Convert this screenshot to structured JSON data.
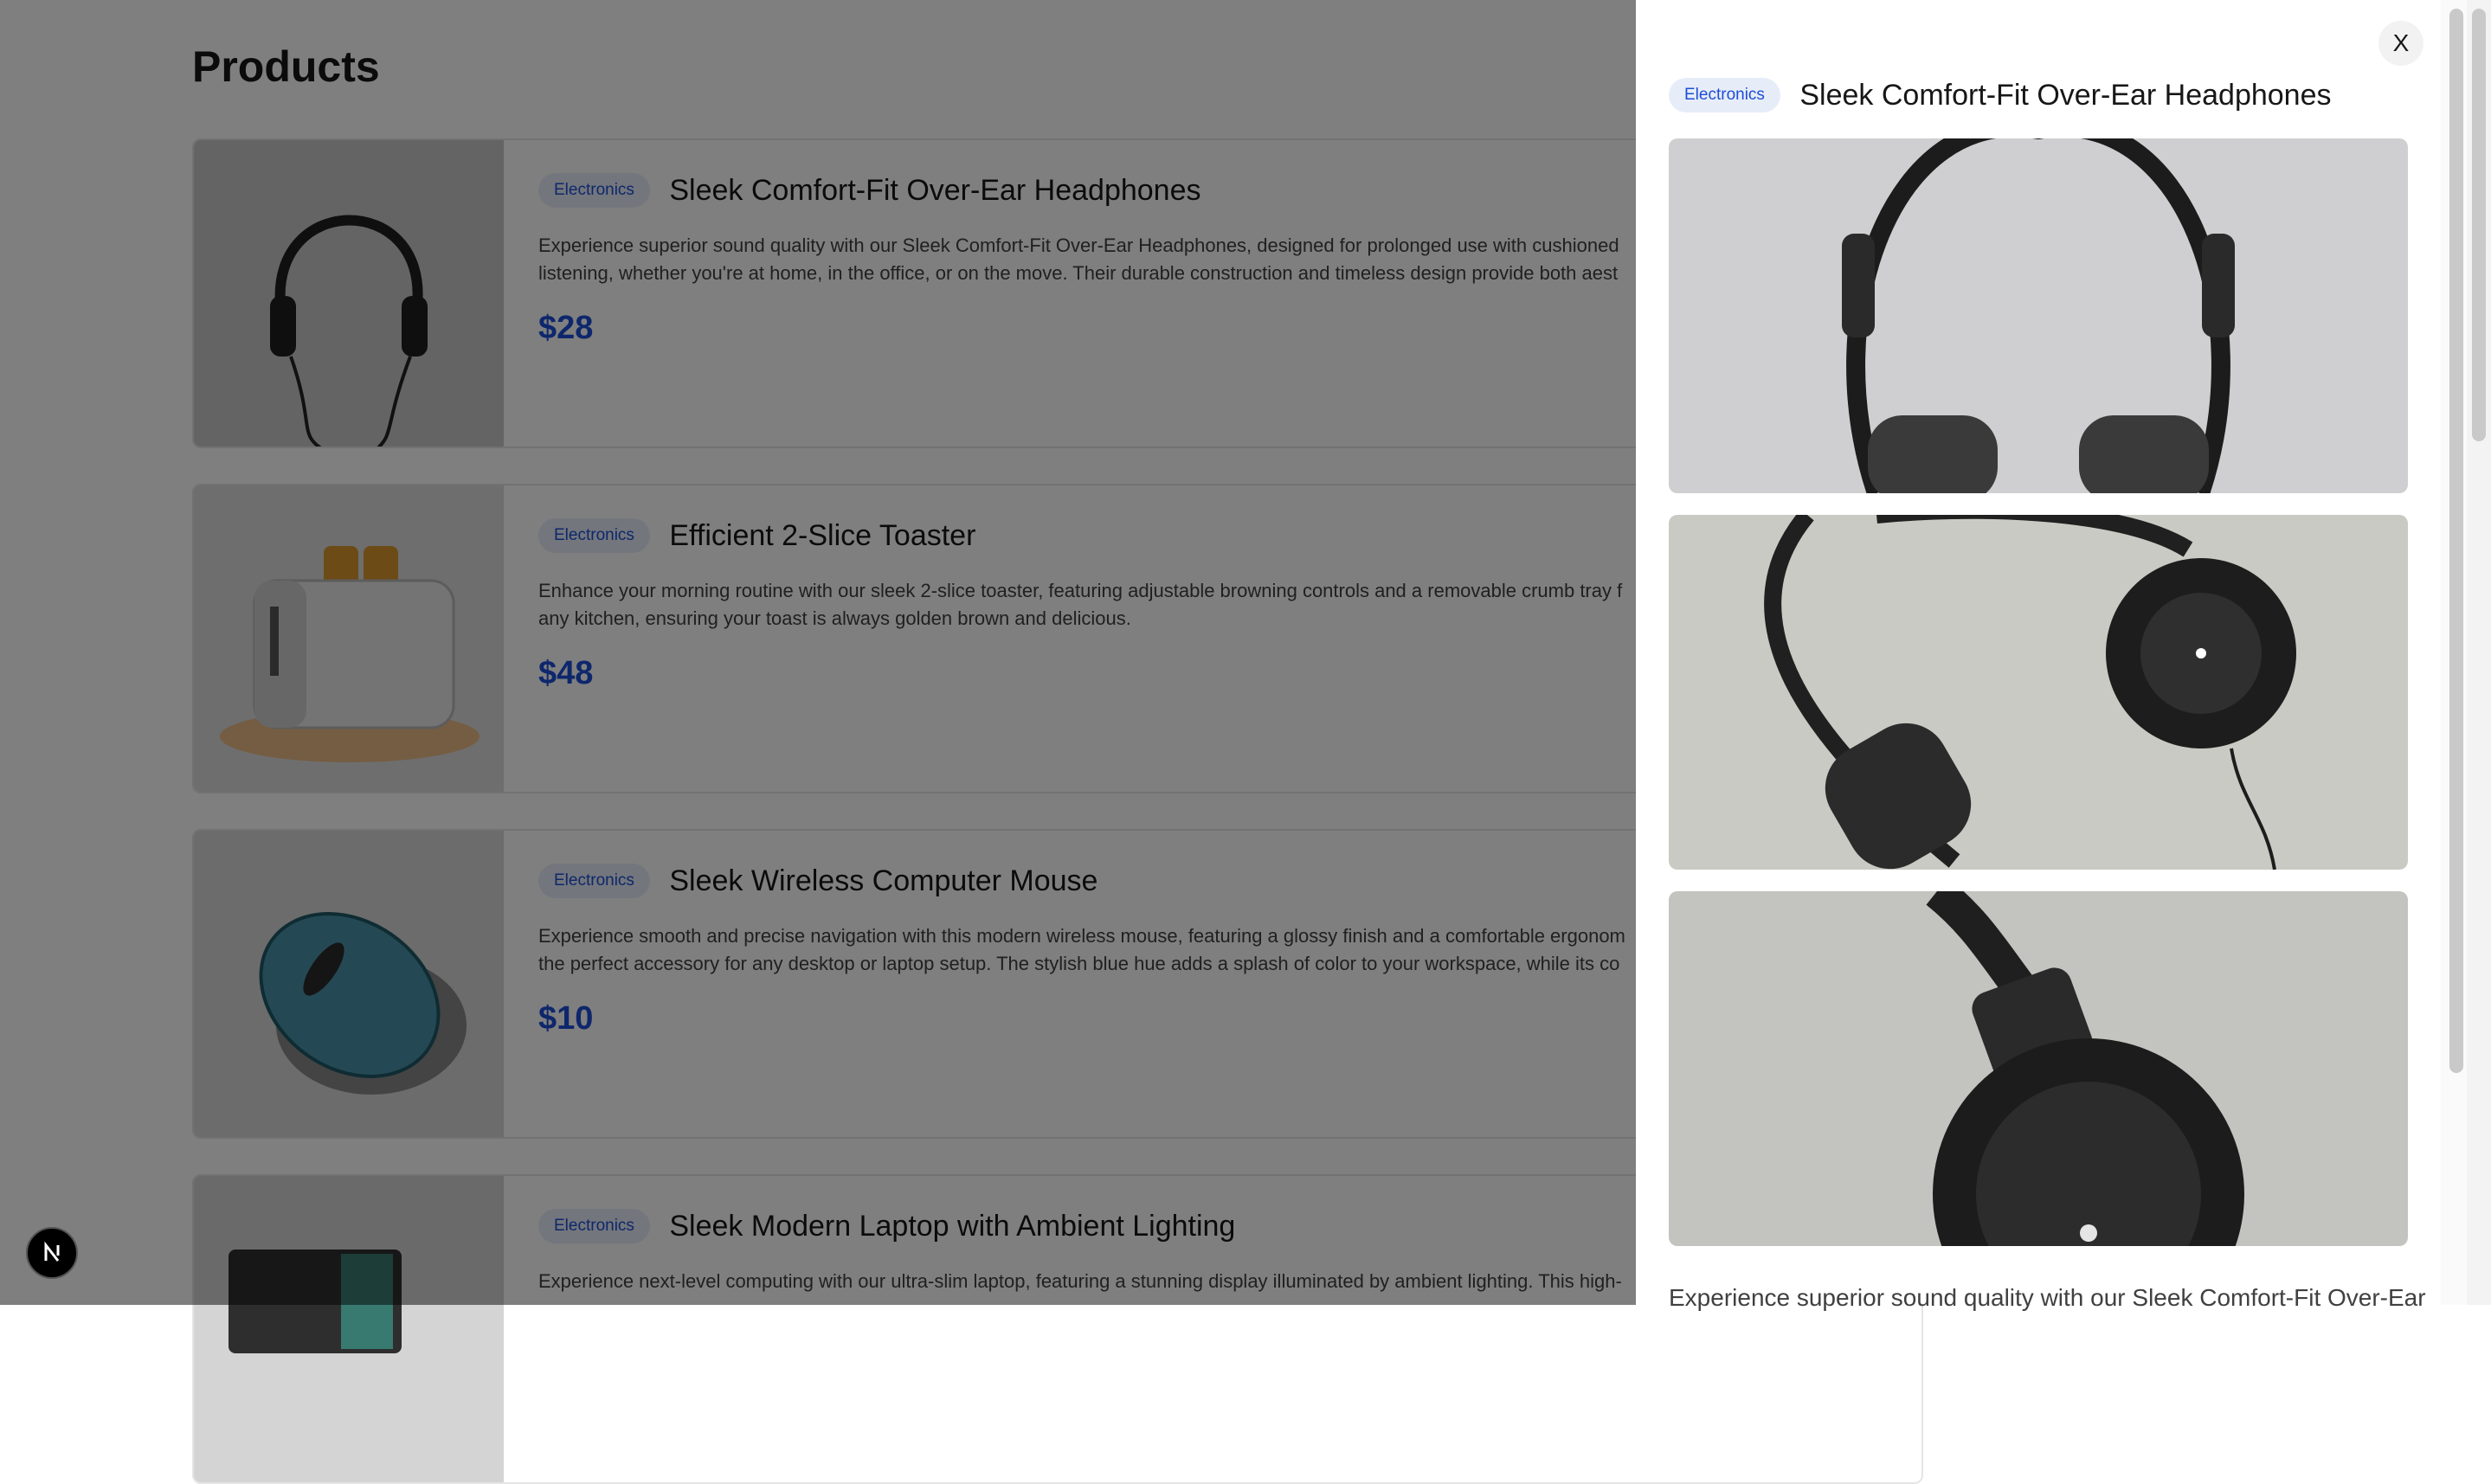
{
  "page": {
    "title": "Products"
  },
  "products": [
    {
      "category": "Electronics",
      "title": "Sleek Comfort-Fit Over-Ear Headphones",
      "description_line1": "Experience superior sound quality with our Sleek Comfort-Fit Over-Ear Headphones, designed for prolonged use with cushioned",
      "description_line2": "listening, whether you're at home, in the office, or on the move. Their durable construction and timeless design provide both aest",
      "price": "$28"
    },
    {
      "category": "Electronics",
      "title": "Efficient 2-Slice Toaster",
      "description_line1": "Enhance your morning routine with our sleek 2-slice toaster, featuring adjustable browning controls and a removable crumb tray f",
      "description_line2": "any kitchen, ensuring your toast is always golden brown and delicious.",
      "price": "$48"
    },
    {
      "category": "Electronics",
      "title": "Sleek Wireless Computer Mouse",
      "description_line1": "Experience smooth and precise navigation with this modern wireless mouse, featuring a glossy finish and a comfortable ergonom",
      "description_line2": "the perfect accessory for any desktop or laptop setup. The stylish blue hue adds a splash of color to your workspace, while its co",
      "price": "$10"
    },
    {
      "category": "Electronics",
      "title": "Sleek Modern Laptop with Ambient Lighting",
      "description_line1": "Experience next-level computing with our ultra-slim laptop, featuring a stunning display illuminated by ambient lighting. This high-",
      "description_line2": "",
      "price": ""
    }
  ],
  "drawer": {
    "close_label": "X",
    "category": "Electronics",
    "title": "Sleek Comfort-Fit Over-Ear Headphones",
    "description": "Experience superior sound quality with our Sleek Comfort-Fit Over-Ear"
  },
  "badge": {
    "label": "N"
  },
  "colors": {
    "accent": "#1d4ed8",
    "tag_bg": "#e7edf8",
    "overlay": "rgba(0,0,0,0.5)"
  },
  "icons": {
    "close": "close-icon",
    "badge": "nextjs-logo-icon"
  }
}
